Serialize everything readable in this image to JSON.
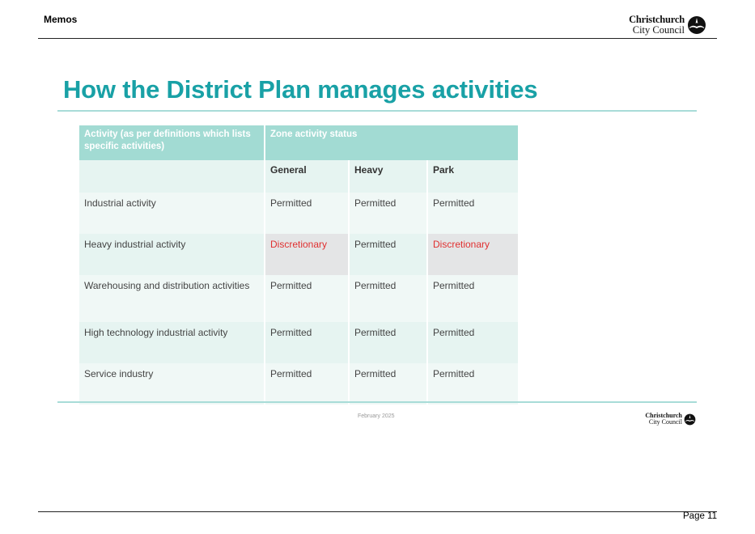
{
  "header": {
    "section_label": "Memos",
    "logo": {
      "line1": "Christchurch",
      "line2": "City Council"
    }
  },
  "slide": {
    "title": "How the District Plan manages activities",
    "table": {
      "col1_header": "Activity (as per definitions which lists specific activities)",
      "zone_header": "Zone activity status",
      "zones": [
        "General",
        "Heavy",
        "Park"
      ],
      "rows": [
        {
          "activity": "Industrial activity",
          "general": "Permitted",
          "heavy": "Permitted",
          "park": "Permitted"
        },
        {
          "activity": "Heavy industrial activity",
          "general": "Discretionary",
          "heavy": "Permitted",
          "park": "Discretionary"
        },
        {
          "activity": "Warehousing and distribution activities",
          "general": "Permitted",
          "heavy": "Permitted",
          "park": "Permitted"
        },
        {
          "activity": "High technology industrial activity",
          "general": "Permitted",
          "heavy": "Permitted",
          "park": "Permitted"
        },
        {
          "activity": "Service industry",
          "general": "Permitted",
          "heavy": "Permitted",
          "park": "Permitted"
        }
      ]
    },
    "footer_date": "February 2025",
    "footer_logo": {
      "line1": "Christchurch",
      "line2": "City Council"
    }
  },
  "footer": {
    "page_label": "Page 11"
  },
  "colors": {
    "accent": "#19a1a6",
    "table_header": "#a2dbd3",
    "discretionary": "#e03030"
  }
}
